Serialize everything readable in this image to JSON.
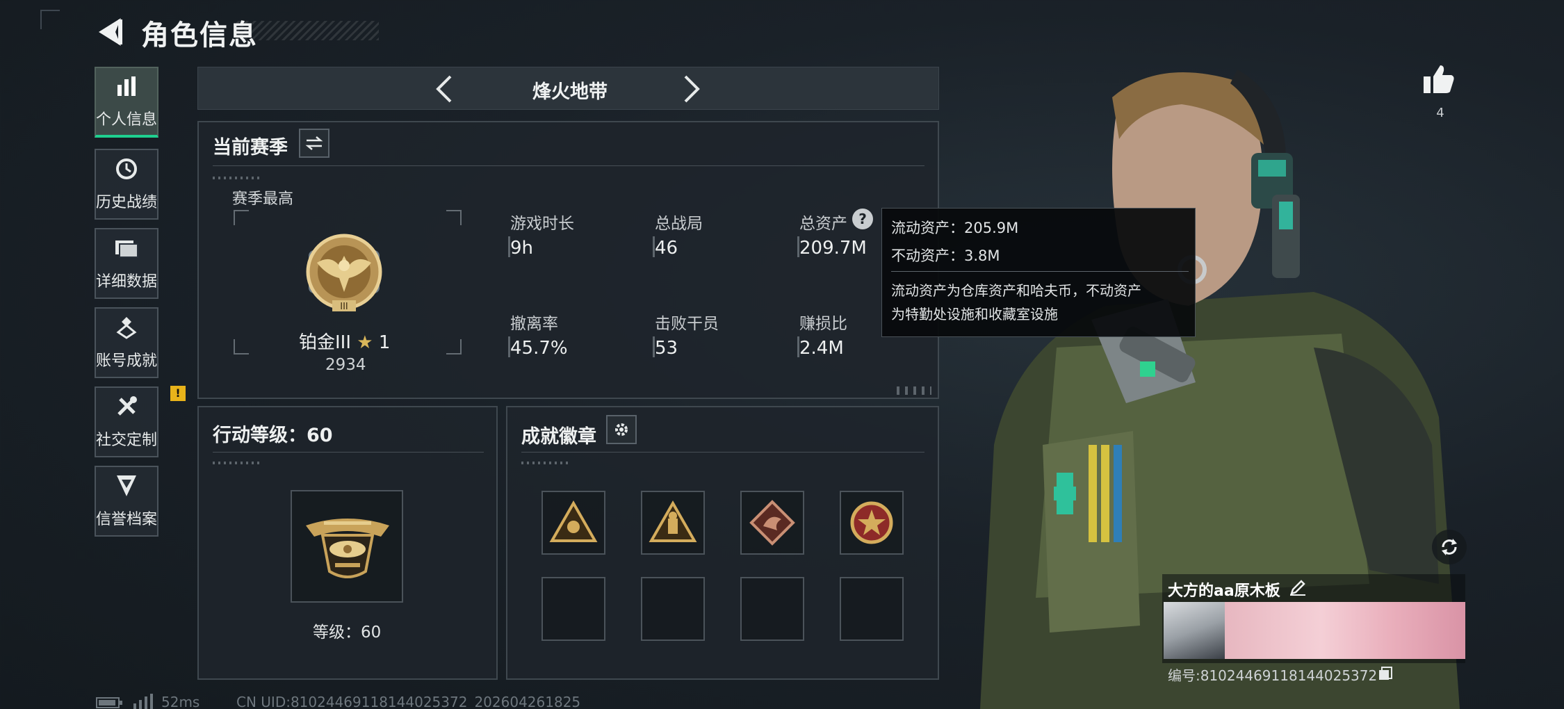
{
  "header": {
    "title": "角色信息"
  },
  "sidebar": {
    "items": [
      {
        "label": "个人信息",
        "icon": "bar-chart-icon",
        "active": true
      },
      {
        "label": "历史战绩",
        "icon": "history-clock-icon"
      },
      {
        "label": "详细数据",
        "icon": "folder-icon"
      },
      {
        "label": "账号成就",
        "icon": "medal-icon"
      },
      {
        "label": "社交定制",
        "icon": "tools-icon"
      },
      {
        "label": "信誉档案",
        "icon": "shield-chevron-icon"
      }
    ],
    "badge": "!"
  },
  "mode": {
    "name": "烽火地带"
  },
  "season": {
    "title": "当前赛季",
    "best_label": "赛季最高",
    "rank_name": "铂金III",
    "rank_stars": "1",
    "rank_score": "2934",
    "stats": [
      {
        "label": "游戏时长",
        "value": "9h"
      },
      {
        "label": "总战局",
        "value": "46"
      },
      {
        "label": "总资产",
        "value": "209.7M"
      },
      {
        "label": "撤离率",
        "value": "45.7%"
      },
      {
        "label": "击败干员",
        "value": "53"
      },
      {
        "label": "赚损比",
        "value": "2.4M"
      }
    ]
  },
  "tooltip": {
    "line1": "流动资产：205.9M",
    "line2": "不动资产：3.8M",
    "desc1": "流动资产为仓库资产和哈夫币，不动资产",
    "desc2": "为特勤处设施和收藏室设施"
  },
  "action_level": {
    "title": "行动等级：60",
    "level_text": "等级：60"
  },
  "achievements": {
    "title": "成就徽章",
    "badges": [
      "triangle-emblem-icon",
      "triangle-soldier-icon",
      "dragon-diamond-icon",
      "star-round-emblem-icon"
    ]
  },
  "player": {
    "name": "大方的aa原木板",
    "id": "编号:81024469118144025372"
  },
  "likes": {
    "count": "4"
  },
  "footer": {
    "ping": "52ms",
    "uid": "CN UID:81024469118144025372_202604261825"
  },
  "colors": {
    "accent": "#1fd08f",
    "badge": "#e8b31a",
    "gold": "#c9a35a"
  }
}
